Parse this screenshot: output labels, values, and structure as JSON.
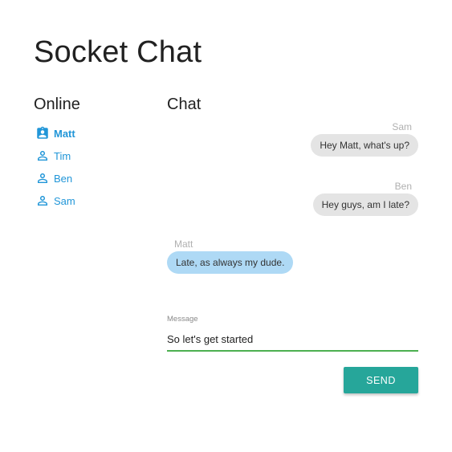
{
  "app": {
    "title": "Socket Chat"
  },
  "sidebar": {
    "heading": "Online",
    "users": [
      {
        "name": "Matt",
        "active": true,
        "icon": "account-badge-icon"
      },
      {
        "name": "Tim",
        "active": false,
        "icon": "account-outline-icon"
      },
      {
        "name": "Ben",
        "active": false,
        "icon": "account-outline-icon"
      },
      {
        "name": "Sam",
        "active": false,
        "icon": "account-outline-icon"
      }
    ]
  },
  "chat": {
    "heading": "Chat",
    "messages": [
      {
        "sender": "Sam",
        "text": "Hey Matt, what's up?",
        "own": false
      },
      {
        "sender": "Ben",
        "text": "Hey guys, am I late?",
        "own": false
      },
      {
        "sender": "Matt",
        "text": "Late, as always my dude.",
        "own": true
      }
    ]
  },
  "composer": {
    "label": "Message",
    "value": "So let's get started",
    "send_label": "SEND"
  },
  "colors": {
    "link_blue": "#2196d8",
    "incoming_bubble": "#e4e4e4",
    "own_bubble": "#aed9f5",
    "input_underline": "#4caf50",
    "send_button": "#26a69a"
  }
}
